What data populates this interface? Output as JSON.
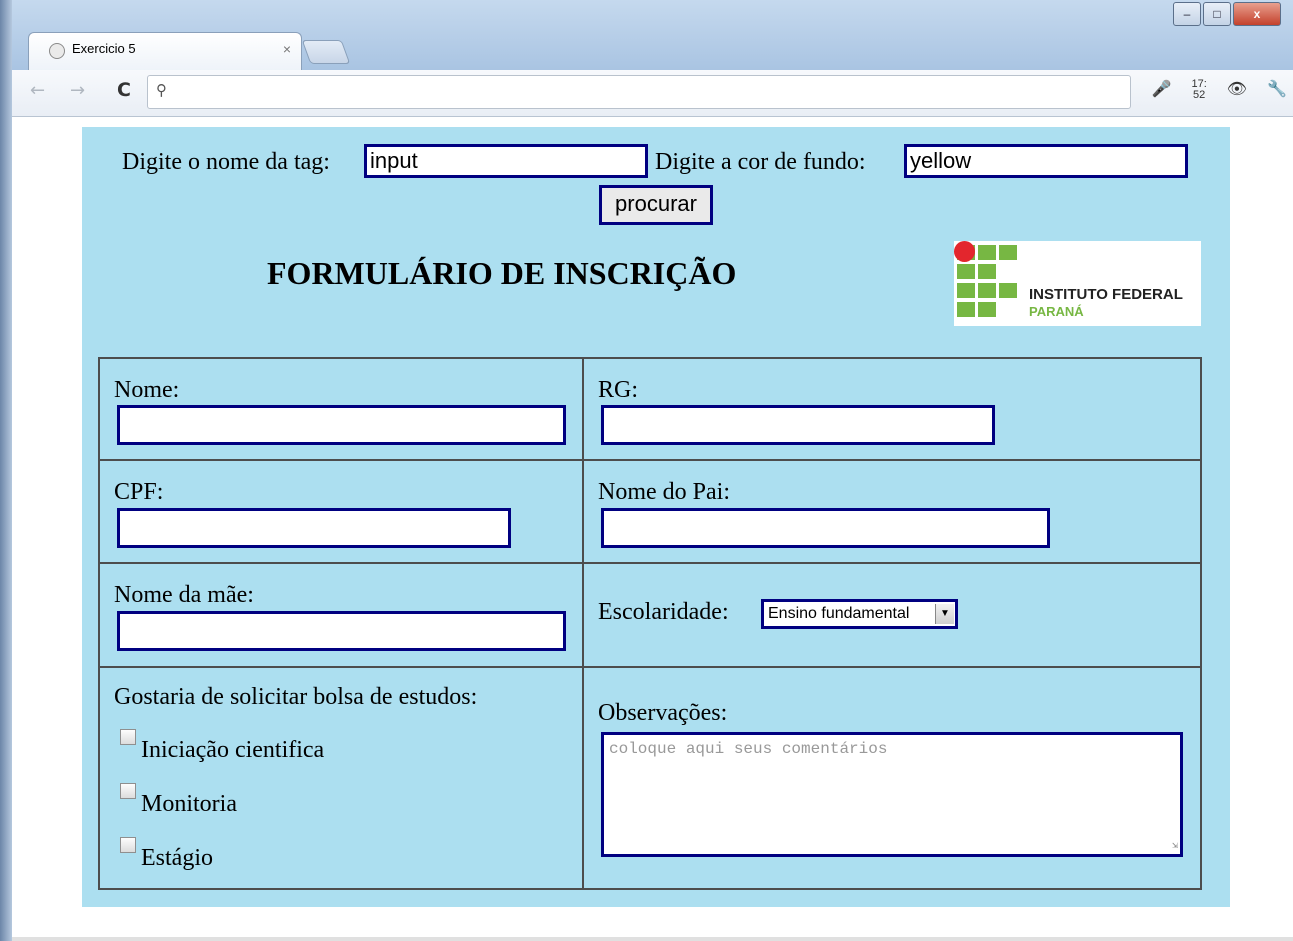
{
  "browser": {
    "tab_title": "Exercicio 5",
    "tab_close": "×",
    "window_min": "–",
    "window_max": "□",
    "window_close": "x",
    "back_icon": "←",
    "forward_icon": "→",
    "reload_icon": "C",
    "search_icon": "⚲",
    "address_value": "",
    "clock": "17:\n52"
  },
  "search": {
    "tag_label": "Digite o nome da tag:",
    "tag_value": "input",
    "color_label": "Digite a cor de fundo:",
    "color_value": "yellow",
    "button_label": "procurar"
  },
  "heading": "FORMULÁRIO DE INSCRIÇÃO",
  "logo": {
    "line1": "INSTITUTO FEDERAL",
    "line2": "PARANÁ",
    "green": "#77b743",
    "red": "#e3262d"
  },
  "form": {
    "nome_label": "Nome:",
    "nome_value": "",
    "rg_label": "RG:",
    "rg_value": "",
    "cpf_label": "CPF:",
    "cpf_value": "",
    "pai_label": "Nome do Pai:",
    "pai_value": "",
    "mae_label": "Nome da mãe:",
    "mae_value": "",
    "escolaridade_label": "Escolaridade:",
    "escolaridade_selected": "Ensino fundamental",
    "bolsa_label": "Gostaria de solicitar bolsa de estudos:",
    "bolsa_options": [
      {
        "label": "Iniciação cientifica",
        "checked": false
      },
      {
        "label": "Monitoria",
        "checked": false
      },
      {
        "label": "Estágio",
        "checked": false
      }
    ],
    "obs_label": "Observações:",
    "obs_placeholder": "coloque aqui seus comentários"
  },
  "colors": {
    "panel_bg": "#acdff0",
    "input_border": "#000080"
  }
}
